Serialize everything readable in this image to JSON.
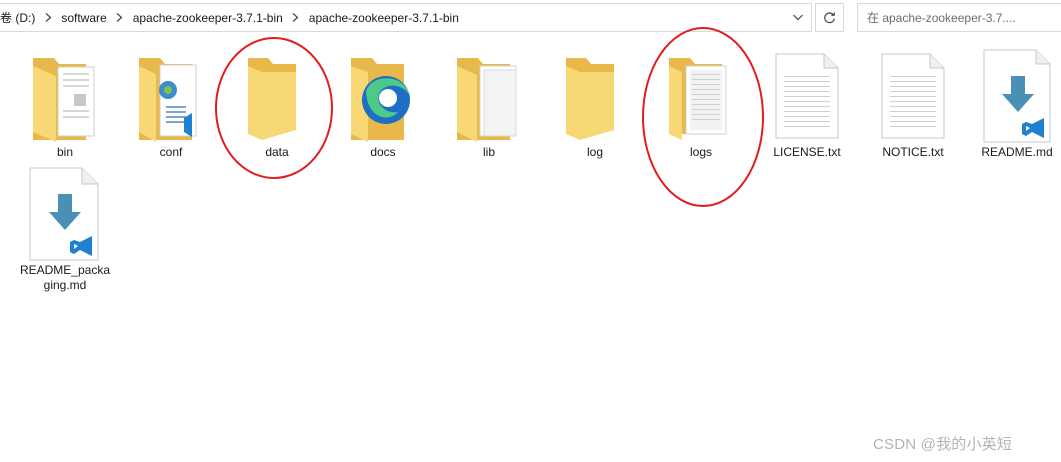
{
  "address_bar": {
    "crumbs": [
      "卷 (D:)",
      "software",
      "apache-zookeeper-3.7.1-bin",
      "apache-zookeeper-3.7.1-bin"
    ]
  },
  "search": {
    "placeholder": "在 apache-zookeeper-3.7...."
  },
  "items": [
    {
      "name": "bin",
      "kind": "folder-documents"
    },
    {
      "name": "conf",
      "kind": "folder-config"
    },
    {
      "name": "data",
      "kind": "folder-empty"
    },
    {
      "name": "docs",
      "kind": "folder-edge"
    },
    {
      "name": "lib",
      "kind": "folder-documents"
    },
    {
      "name": "log",
      "kind": "folder-empty"
    },
    {
      "name": "logs",
      "kind": "folder-text"
    },
    {
      "name": "LICENSE.txt",
      "kind": "text-file"
    },
    {
      "name": "NOTICE.txt",
      "kind": "text-file"
    },
    {
      "name": "README.md",
      "kind": "markdown-file"
    },
    {
      "name": "README_packaging.md",
      "label_lines": [
        "README_packa",
        "ging.md"
      ],
      "kind": "markdown-file"
    }
  ],
  "watermark": "CSDN @我的小英短",
  "colors": {
    "folder_back": "#e8b94a",
    "folder_front": "#f8d775",
    "annotation": "#e01e1e",
    "vscode_blue": "#1f80d0",
    "download_arrow": "#4a8fb5"
  }
}
